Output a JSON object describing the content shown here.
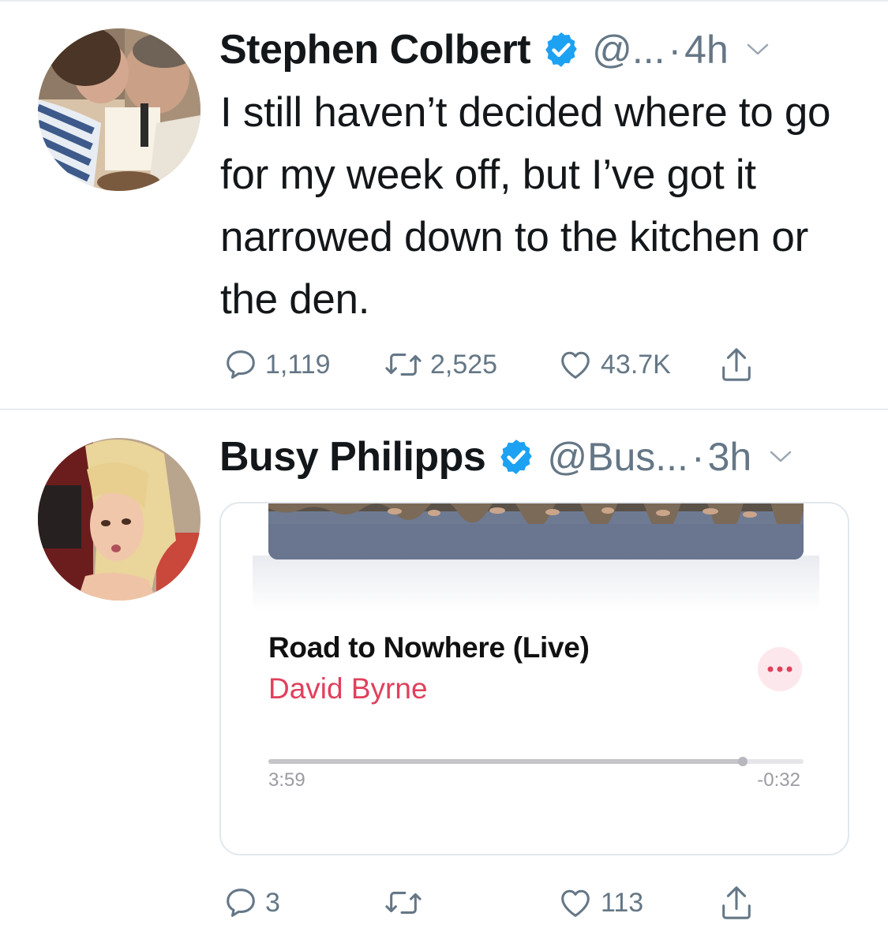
{
  "tweets": [
    {
      "author_name": "Stephen Colbert",
      "handle": "@...",
      "separator": "·",
      "time": "4h",
      "text": "I still haven’t decided where to go for my week off, but I’ve got it narrowed down to the kitchen or the den.",
      "replies": "1,119",
      "retweets": "2,525",
      "likes": "43.7K"
    },
    {
      "author_name": "Busy Philipps",
      "handle": "@Bus...",
      "separator": "·",
      "time": "3h",
      "card": {
        "track_title": "Road to Nowhere (Live)",
        "artist": "David Byrne",
        "elapsed": "3:59",
        "remaining": "-0:32",
        "progress": 0.887
      },
      "replies": "3",
      "retweets": "",
      "likes": "113"
    }
  ],
  "icons": {
    "verified": "verified-badge-icon",
    "chevron": "chevron-down-icon",
    "reply": "reply-icon",
    "retweet": "retweet-icon",
    "like": "heart-icon",
    "share": "share-icon",
    "more": "more-options-icon"
  },
  "colors": {
    "verified_blue": "#1da1f2",
    "text_primary": "#14171a",
    "text_secondary": "#657786",
    "artist_pink": "#e0405c"
  }
}
